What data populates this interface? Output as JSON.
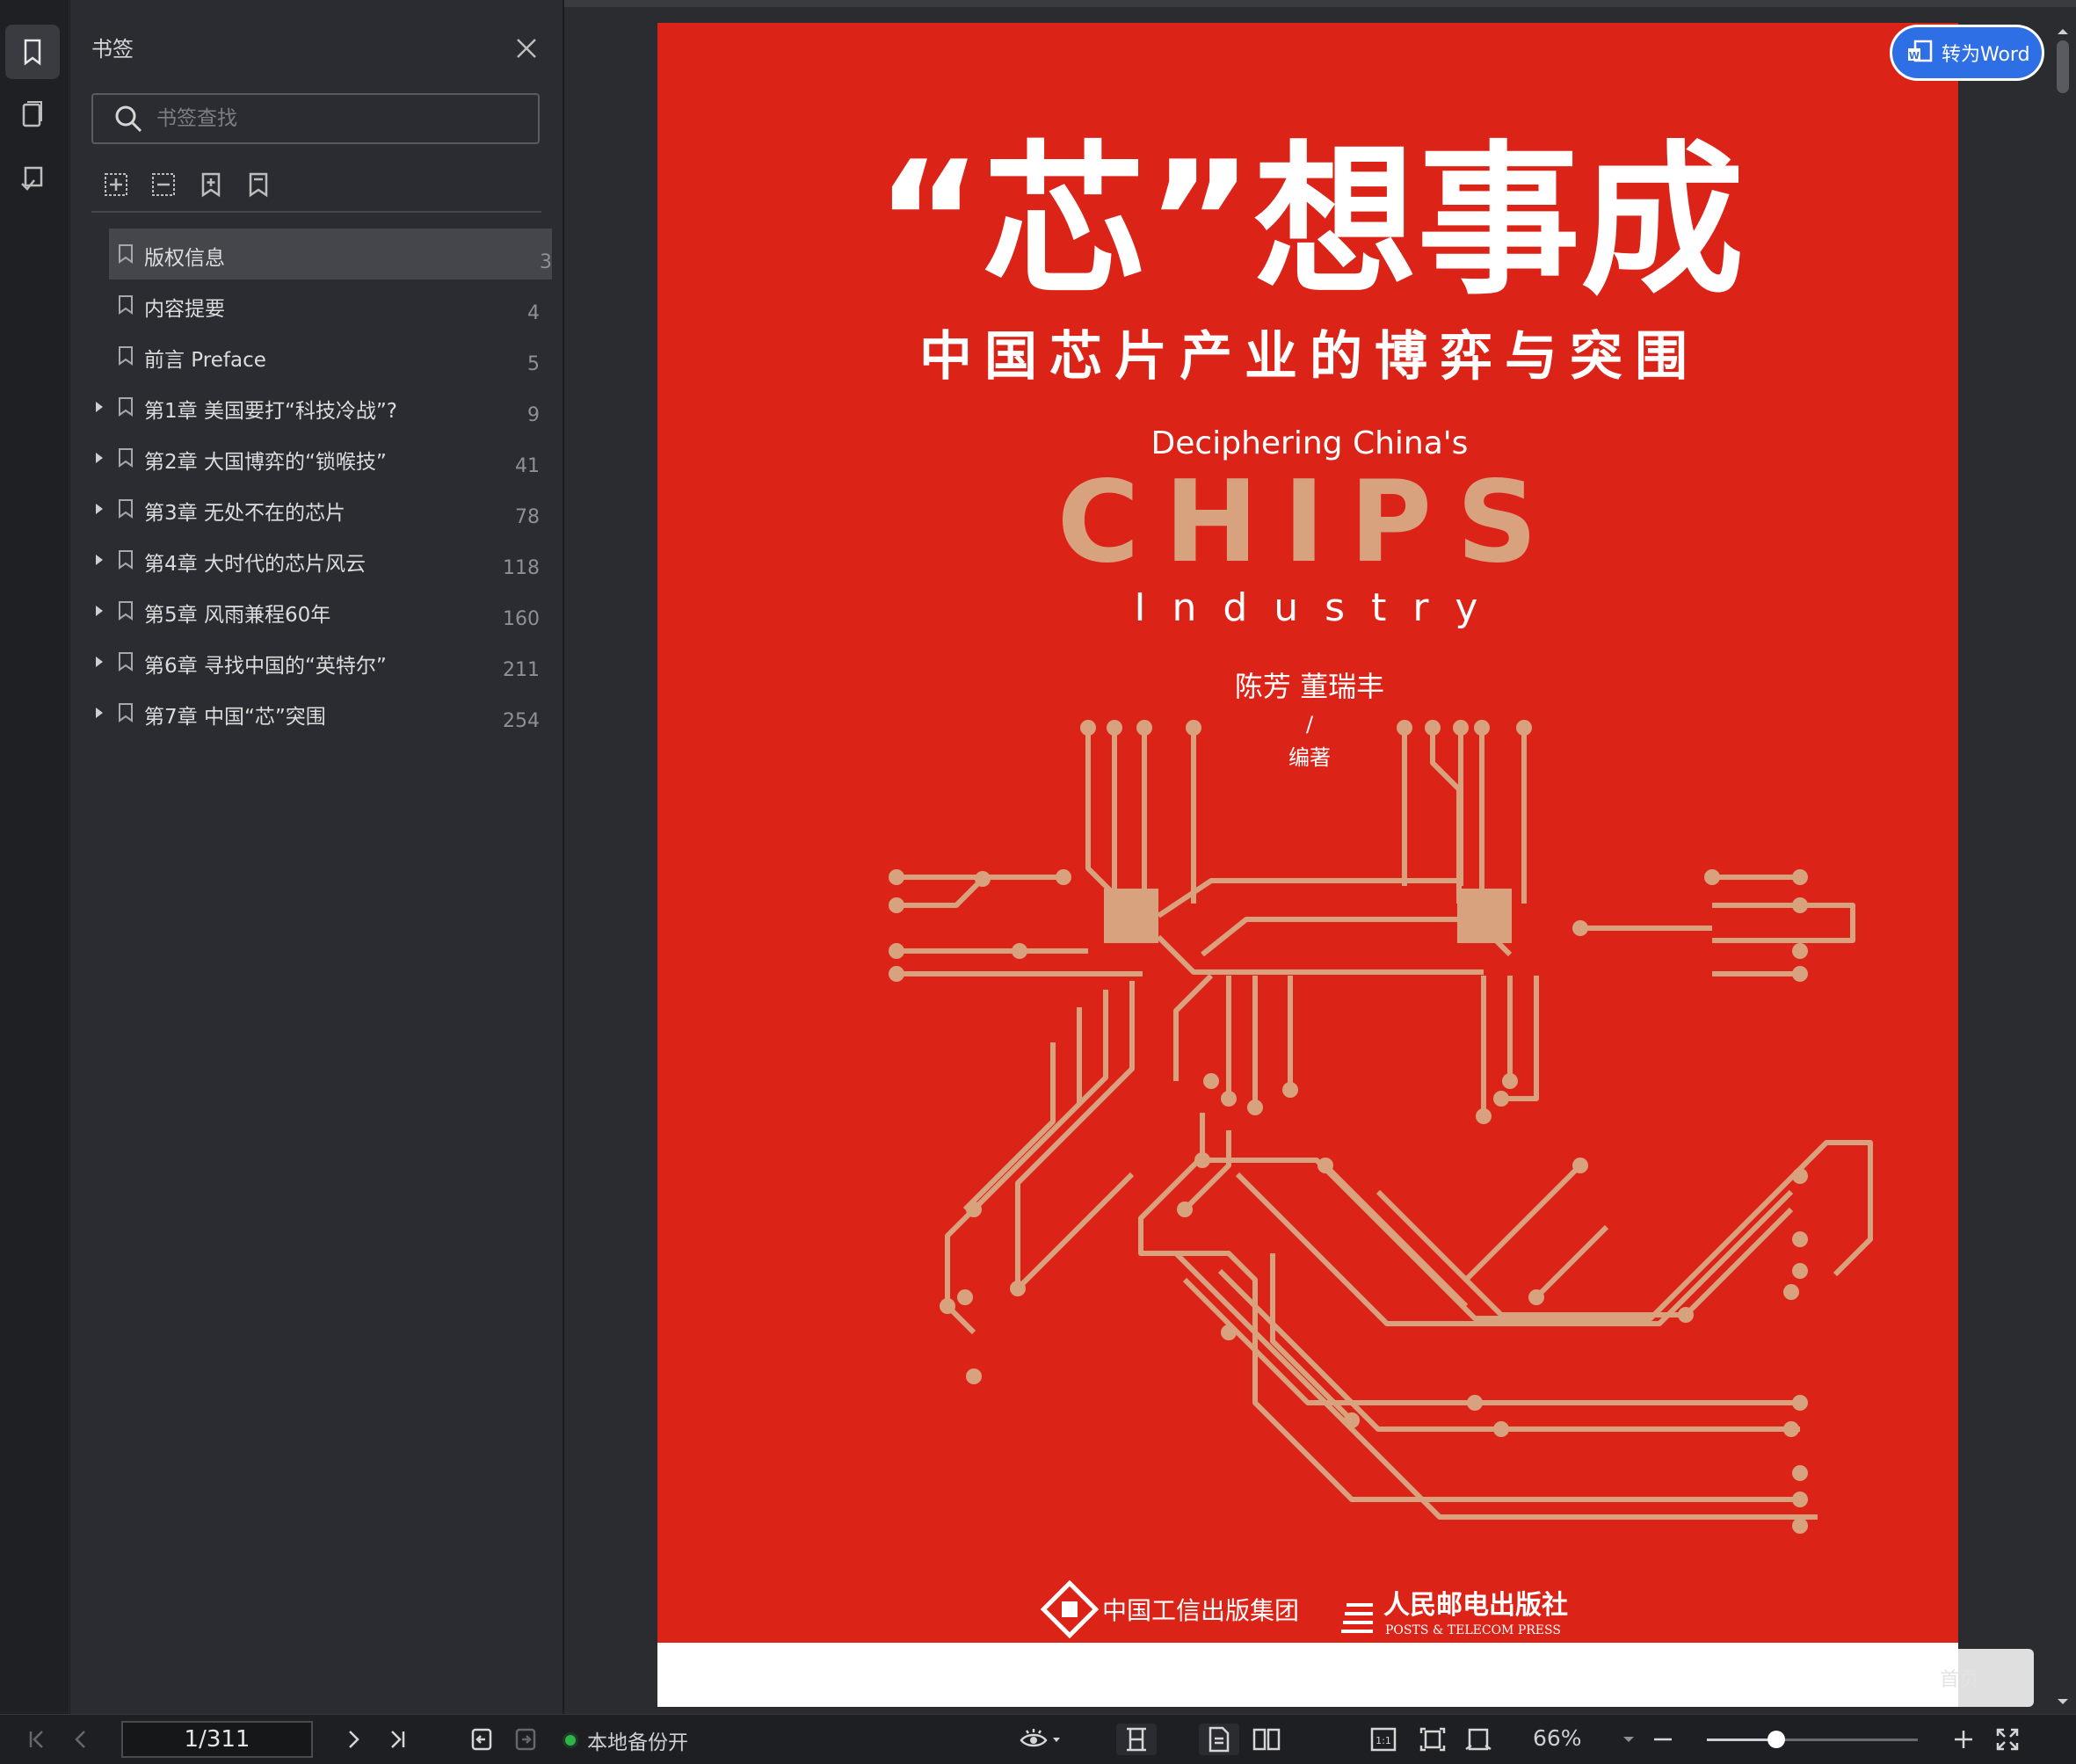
{
  "sidebar": {
    "title": "书签",
    "search_placeholder": "书签查找",
    "items": [
      {
        "label": "版权信息",
        "page": "3",
        "expandable": false,
        "selected": true
      },
      {
        "label": "内容提要",
        "page": "4",
        "expandable": false,
        "selected": false
      },
      {
        "label": "前言 Preface",
        "page": "5",
        "expandable": false,
        "selected": false
      },
      {
        "label": "第1章 美国要打“科技冷战”?",
        "page": "9",
        "expandable": true,
        "selected": false
      },
      {
        "label": "第2章 大国博弈的“锁喉技”",
        "page": "41",
        "expandable": true,
        "selected": false
      },
      {
        "label": "第3章 无处不在的芯片",
        "page": "78",
        "expandable": true,
        "selected": false
      },
      {
        "label": "第4章 大时代的芯片风云",
        "page": "118",
        "expandable": true,
        "selected": false
      },
      {
        "label": "第5章 风雨兼程60年",
        "page": "160",
        "expandable": true,
        "selected": false
      },
      {
        "label": "第6章 寻找中国的“英特尔”",
        "page": "211",
        "expandable": true,
        "selected": false
      },
      {
        "label": "第7章 中国“芯”突围",
        "page": "254",
        "expandable": true,
        "selected": false
      }
    ]
  },
  "viewer": {
    "convert_button": "转为Word",
    "float_button": "首页"
  },
  "cover": {
    "title": "“芯”想事成",
    "subtitle": "中国芯片产业的博弈与突围",
    "en_line1": "Deciphering China's",
    "en_line2": "CHIPS",
    "en_line3": "I n d u s t r y",
    "authors": "陈芳  董瑞丰",
    "slash": "/",
    "role": "编著",
    "publisher1": "中国工信出版集团",
    "publisher2": "人民邮电出版社",
    "publisher2_en": "POSTS & TELECOM PRESS",
    "colors": {
      "background": "#dc2317",
      "accent": "#d9a27f",
      "white": "#ffffff"
    }
  },
  "statusbar": {
    "page_indicator": "1/311",
    "backup_status": "本地备份开",
    "zoom": "66%",
    "zoom_fraction": 0.33
  },
  "colors": {
    "accent": "#2f6fe6",
    "status_ok": "#2db54a"
  }
}
